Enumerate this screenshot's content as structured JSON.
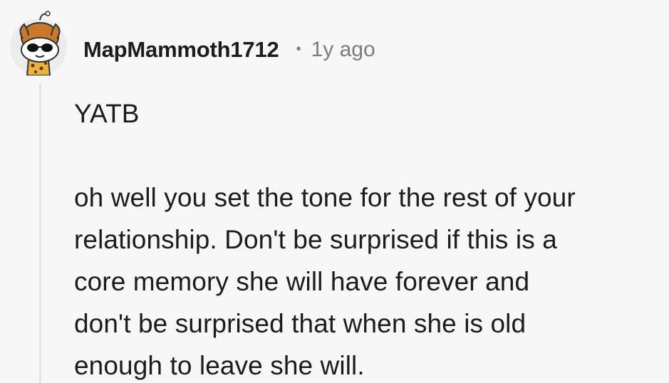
{
  "comment": {
    "username": "MapMammoth1712",
    "separator": "•",
    "timestamp": "1y ago",
    "avatar_icon": "snoo-avatar-icon",
    "paragraphs": [
      {
        "lines": [
          "YATB"
        ]
      },
      {
        "lines": [
          "oh well you set the tone for the rest of your",
          "relationship. Don't be surprised if this is a",
          "core memory she will have forever and",
          "don't be surprised that when she is old",
          "enough to leave she will."
        ]
      }
    ]
  },
  "colors": {
    "background": "#f7f7f7",
    "text": "#1c1c1c",
    "meta": "#7c7c7c",
    "thread_line": "#e3e3e3"
  }
}
